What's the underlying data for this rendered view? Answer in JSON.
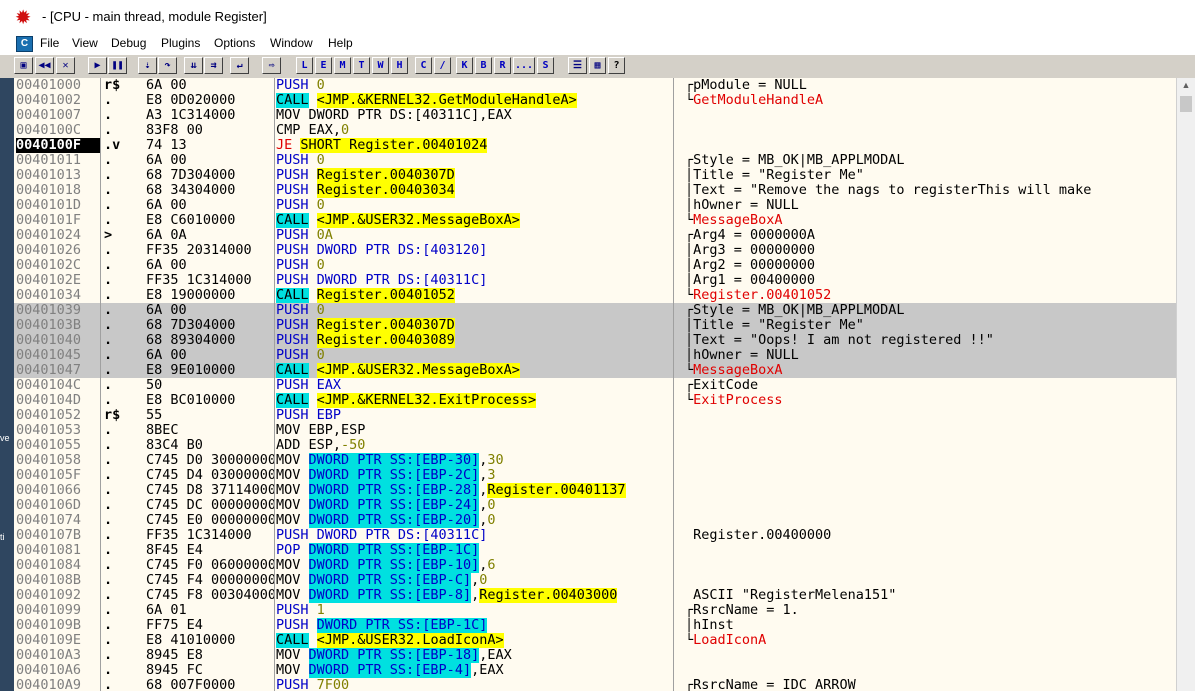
{
  "window": {
    "title": "- [CPU - main thread, module Register]"
  },
  "menu": [
    "File",
    "View",
    "Debug",
    "Plugins",
    "Options",
    "Window",
    "Help"
  ],
  "toolbar": {
    "icons": [
      "open-icon",
      "rewind-icon",
      "close-icon",
      "run-icon",
      "pause-icon",
      "step-into-icon",
      "step-over-icon",
      "trace-into-icon",
      "trace-over-icon",
      "execute-till-return-icon",
      "goto-icon",
      "list-icon",
      "grid-icon",
      "help-icon"
    ],
    "letters": [
      "L",
      "E",
      "M",
      "T",
      "W",
      "H",
      "C",
      "/",
      "K",
      "B",
      "R",
      "...",
      "S"
    ],
    "help": "?"
  },
  "desktop_strip": [
    "OF",
    "ve",
    "ti"
  ],
  "rows": [
    {
      "addr": "00401000",
      "mark": "r$",
      "hex": "6A 00",
      "dis": [
        [
          "PUSH ",
          "push"
        ],
        [
          "0",
          "imm"
        ]
      ],
      "com": [
        [
          "pModule = NULL",
          ""
        ]
      ],
      "brk": "top"
    },
    {
      "addr": "00401002",
      "mark": ".",
      "hex": "E8 0D020000",
      "dis": [
        [
          "CALL",
          "call"
        ],
        [
          " ",
          ""
        ],
        [
          "<JMP.&KERNEL32.GetModuleHandleA>",
          "jmp"
        ]
      ],
      "com": [
        [
          "GetModuleHandleA",
          "red"
        ]
      ],
      "brk": "bot"
    },
    {
      "addr": "00401007",
      "mark": ".",
      "hex": "A3 1C314000",
      "dis": [
        [
          "MOV DWORD PTR DS:[40311C],EAX",
          ""
        ]
      ],
      "com": []
    },
    {
      "addr": "0040100C",
      "mark": ".",
      "hex": "83F8 00",
      "dis": [
        [
          "CMP EAX,",
          ""
        ],
        [
          "0",
          "imm"
        ]
      ],
      "com": []
    },
    {
      "addr": "0040100F",
      "mark": ".v",
      "hex": "74 13",
      "dis": [
        [
          "JE",
          "red"
        ],
        [
          " ",
          ""
        ],
        [
          "SHORT Register.00401024",
          "jmp"
        ]
      ],
      "com": [],
      "cur": true
    },
    {
      "addr": "00401011",
      "mark": ".",
      "hex": "6A 00",
      "dis": [
        [
          "PUSH ",
          "push"
        ],
        [
          "0",
          "imm"
        ]
      ],
      "com": [
        [
          "Style = MB_OK|MB_APPLMODAL",
          ""
        ]
      ],
      "brk": "top"
    },
    {
      "addr": "00401013",
      "mark": ".",
      "hex": "68 7D304000",
      "dis": [
        [
          "PUSH ",
          "push"
        ],
        [
          "Register.0040307D",
          "jmp"
        ]
      ],
      "com": [
        [
          "Title = \"Register Me\"",
          ""
        ]
      ],
      "brk": "mid"
    },
    {
      "addr": "00401018",
      "mark": ".",
      "hex": "68 34304000",
      "dis": [
        [
          "PUSH ",
          "push"
        ],
        [
          "Register.00403034",
          "jmp"
        ]
      ],
      "com": [
        [
          "Text = \"Remove the nags to registerThis will make",
          ""
        ]
      ],
      "brk": "mid"
    },
    {
      "addr": "0040101D",
      "mark": ".",
      "hex": "6A 00",
      "dis": [
        [
          "PUSH ",
          "push"
        ],
        [
          "0",
          "imm"
        ]
      ],
      "com": [
        [
          "hOwner = NULL",
          ""
        ]
      ],
      "brk": "mid"
    },
    {
      "addr": "0040101F",
      "mark": ".",
      "hex": "E8 C6010000",
      "dis": [
        [
          "CALL",
          "call"
        ],
        [
          " ",
          ""
        ],
        [
          "<JMP.&USER32.MessageBoxA>",
          "jmp"
        ]
      ],
      "com": [
        [
          "MessageBoxA",
          "red"
        ]
      ],
      "brk": "bot"
    },
    {
      "addr": "00401024",
      "mark": ">",
      "hex": "6A 0A",
      "dis": [
        [
          "PUSH ",
          "push"
        ],
        [
          "0A",
          "imm"
        ]
      ],
      "com": [
        [
          "Arg4 = 0000000A",
          ""
        ]
      ],
      "brk": "top"
    },
    {
      "addr": "00401026",
      "mark": ".",
      "hex": "FF35 20314000",
      "dis": [
        [
          "PUSH DWORD PTR DS:[403120]",
          "push"
        ]
      ],
      "com": [
        [
          "Arg3 = 00000000",
          ""
        ]
      ],
      "brk": "mid"
    },
    {
      "addr": "0040102C",
      "mark": ".",
      "hex": "6A 00",
      "dis": [
        [
          "PUSH ",
          "push"
        ],
        [
          "0",
          "imm"
        ]
      ],
      "com": [
        [
          "Arg2 = 00000000",
          ""
        ]
      ],
      "brk": "mid"
    },
    {
      "addr": "0040102E",
      "mark": ".",
      "hex": "FF35 1C314000",
      "dis": [
        [
          "PUSH DWORD PTR DS:[40311C]",
          "push"
        ]
      ],
      "com": [
        [
          "Arg1 = 00400000",
          ""
        ]
      ],
      "brk": "mid"
    },
    {
      "addr": "00401034",
      "mark": ".",
      "hex": "E8 19000000",
      "dis": [
        [
          "CALL",
          "call"
        ],
        [
          " ",
          ""
        ],
        [
          "Register.00401052",
          "jmp"
        ]
      ],
      "com": [
        [
          "Register.00401052",
          "red"
        ]
      ],
      "brk": "bot"
    },
    {
      "addr": "00401039",
      "mark": ".",
      "hex": "6A 00",
      "dis": [
        [
          "PUSH ",
          "push"
        ],
        [
          "0",
          "imm"
        ]
      ],
      "com": [
        [
          "Style = MB_OK|MB_APPLMODAL",
          ""
        ]
      ],
      "brk": "top",
      "sel": true
    },
    {
      "addr": "0040103B",
      "mark": ".",
      "hex": "68 7D304000",
      "dis": [
        [
          "PUSH ",
          "push"
        ],
        [
          "Register.0040307D",
          "jmp"
        ]
      ],
      "com": [
        [
          "Title = \"Register Me\"",
          ""
        ]
      ],
      "brk": "mid",
      "sel": true
    },
    {
      "addr": "00401040",
      "mark": ".",
      "hex": "68 89304000",
      "dis": [
        [
          "PUSH ",
          "push"
        ],
        [
          "Register.00403089",
          "jmp"
        ]
      ],
      "com": [
        [
          "Text = \"Oops! I am not registered !!\"",
          ""
        ]
      ],
      "brk": "mid",
      "sel": true
    },
    {
      "addr": "00401045",
      "mark": ".",
      "hex": "6A 00",
      "dis": [
        [
          "PUSH ",
          "push"
        ],
        [
          "0",
          "imm"
        ]
      ],
      "com": [
        [
          "hOwner = NULL",
          ""
        ]
      ],
      "brk": "mid",
      "sel": true
    },
    {
      "addr": "00401047",
      "mark": ".",
      "hex": "E8 9E010000",
      "dis": [
        [
          "CALL",
          "call"
        ],
        [
          " ",
          ""
        ],
        [
          "<JMP.&USER32.MessageBoxA>",
          "jmp"
        ]
      ],
      "com": [
        [
          "MessageBoxA",
          "red"
        ]
      ],
      "brk": "bot",
      "sel": true
    },
    {
      "addr": "0040104C",
      "mark": ".",
      "hex": "50",
      "dis": [
        [
          "PUSH EAX",
          "push"
        ]
      ],
      "com": [
        [
          "ExitCode",
          ""
        ]
      ],
      "brk": "top"
    },
    {
      "addr": "0040104D",
      "mark": ".",
      "hex": "E8 BC010000",
      "dis": [
        [
          "CALL",
          "call"
        ],
        [
          " ",
          ""
        ],
        [
          "<JMP.&KERNEL32.ExitProcess>",
          "jmp"
        ]
      ],
      "com": [
        [
          "ExitProcess",
          "red"
        ]
      ],
      "brk": "bot"
    },
    {
      "addr": "00401052",
      "mark": "r$",
      "hex": "55",
      "dis": [
        [
          "PUSH EBP",
          "push"
        ]
      ],
      "com": []
    },
    {
      "addr": "00401053",
      "mark": ".",
      "hex": "8BEC",
      "dis": [
        [
          "MOV EBP,ESP",
          ""
        ]
      ],
      "com": []
    },
    {
      "addr": "00401055",
      "mark": ".",
      "hex": "83C4 B0",
      "dis": [
        [
          "ADD ESP,",
          ""
        ],
        [
          "-50",
          "imm"
        ]
      ],
      "com": []
    },
    {
      "addr": "00401058",
      "mark": ".",
      "hex": "C745 D0 30000000",
      "dis": [
        [
          "MOV ",
          ""
        ],
        [
          "DWORD PTR SS:[EBP-30]",
          "mem"
        ],
        [
          ",",
          ""
        ],
        [
          "30",
          "imm"
        ]
      ],
      "com": []
    },
    {
      "addr": "0040105F",
      "mark": ".",
      "hex": "C745 D4 03000000",
      "dis": [
        [
          "MOV ",
          ""
        ],
        [
          "DWORD PTR SS:[EBP-2C]",
          "mem"
        ],
        [
          ",",
          ""
        ],
        [
          "3",
          "imm"
        ]
      ],
      "com": []
    },
    {
      "addr": "00401066",
      "mark": ".",
      "hex": "C745 D8 37114000",
      "dis": [
        [
          "MOV ",
          ""
        ],
        [
          "DWORD PTR SS:[EBP-28]",
          "mem"
        ],
        [
          ",",
          ""
        ],
        [
          "Register.00401137",
          "jmp"
        ]
      ],
      "com": []
    },
    {
      "addr": "0040106D",
      "mark": ".",
      "hex": "C745 DC 00000000",
      "dis": [
        [
          "MOV ",
          ""
        ],
        [
          "DWORD PTR SS:[EBP-24]",
          "mem"
        ],
        [
          ",",
          ""
        ],
        [
          "0",
          "imm"
        ]
      ],
      "com": []
    },
    {
      "addr": "00401074",
      "mark": ".",
      "hex": "C745 E0 00000000",
      "dis": [
        [
          "MOV ",
          ""
        ],
        [
          "DWORD PTR SS:[EBP-20]",
          "mem"
        ],
        [
          ",",
          ""
        ],
        [
          "0",
          "imm"
        ]
      ],
      "com": []
    },
    {
      "addr": "0040107B",
      "mark": ".",
      "hex": "FF35 1C314000",
      "dis": [
        [
          "PUSH DWORD PTR DS:[40311C]",
          "push"
        ]
      ],
      "com": [
        [
          "Register.00400000",
          ""
        ]
      ]
    },
    {
      "addr": "00401081",
      "mark": ".",
      "hex": "8F45 E4",
      "dis": [
        [
          "POP ",
          "push"
        ],
        [
          "DWORD PTR SS:[EBP-1C]",
          "mem"
        ]
      ],
      "com": []
    },
    {
      "addr": "00401084",
      "mark": ".",
      "hex": "C745 F0 06000000",
      "dis": [
        [
          "MOV ",
          ""
        ],
        [
          "DWORD PTR SS:[EBP-10]",
          "mem"
        ],
        [
          ",",
          ""
        ],
        [
          "6",
          "imm"
        ]
      ],
      "com": []
    },
    {
      "addr": "0040108B",
      "mark": ".",
      "hex": "C745 F4 00000000",
      "dis": [
        [
          "MOV ",
          ""
        ],
        [
          "DWORD PTR SS:[EBP-C]",
          "mem"
        ],
        [
          ",",
          ""
        ],
        [
          "0",
          "imm"
        ]
      ],
      "com": []
    },
    {
      "addr": "00401092",
      "mark": ".",
      "hex": "C745 F8 00304000",
      "dis": [
        [
          "MOV ",
          ""
        ],
        [
          "DWORD PTR SS:[EBP-8]",
          "mem"
        ],
        [
          ",",
          ""
        ],
        [
          "Register.00403000",
          "jmp"
        ]
      ],
      "com": [
        [
          "ASCII \"RegisterMelena151\"",
          ""
        ]
      ]
    },
    {
      "addr": "00401099",
      "mark": ".",
      "hex": "6A 01",
      "dis": [
        [
          "PUSH ",
          "push"
        ],
        [
          "1",
          "imm"
        ]
      ],
      "com": [
        [
          "RsrcName = 1.",
          ""
        ]
      ],
      "brk": "top"
    },
    {
      "addr": "0040109B",
      "mark": ".",
      "hex": "FF75 E4",
      "dis": [
        [
          "PUSH ",
          "push"
        ],
        [
          "DWORD PTR SS:[EBP-1C]",
          "mem"
        ]
      ],
      "com": [
        [
          "hInst",
          ""
        ]
      ],
      "brk": "mid"
    },
    {
      "addr": "0040109E",
      "mark": ".",
      "hex": "E8 41010000",
      "dis": [
        [
          "CALL",
          "call"
        ],
        [
          " ",
          ""
        ],
        [
          "<JMP.&USER32.LoadIconA>",
          "jmp"
        ]
      ],
      "com": [
        [
          "LoadIconA",
          "red"
        ]
      ],
      "brk": "bot"
    },
    {
      "addr": "004010A3",
      "mark": ".",
      "hex": "8945 E8",
      "dis": [
        [
          "MOV ",
          ""
        ],
        [
          "DWORD PTR SS:[EBP-18]",
          "mem"
        ],
        [
          ",EAX",
          ""
        ]
      ],
      "com": []
    },
    {
      "addr": "004010A6",
      "mark": ".",
      "hex": "8945 FC",
      "dis": [
        [
          "MOV ",
          ""
        ],
        [
          "DWORD PTR SS:[EBP-4]",
          "mem"
        ],
        [
          ",EAX",
          ""
        ]
      ],
      "com": []
    },
    {
      "addr": "004010A9",
      "mark": ".",
      "hex": "68 007F0000",
      "dis": [
        [
          "PUSH ",
          "push"
        ],
        [
          "7F00",
          "imm"
        ]
      ],
      "com": [
        [
          "RsrcName = IDC_ARROW",
          ""
        ]
      ],
      "brk": "top"
    }
  ]
}
